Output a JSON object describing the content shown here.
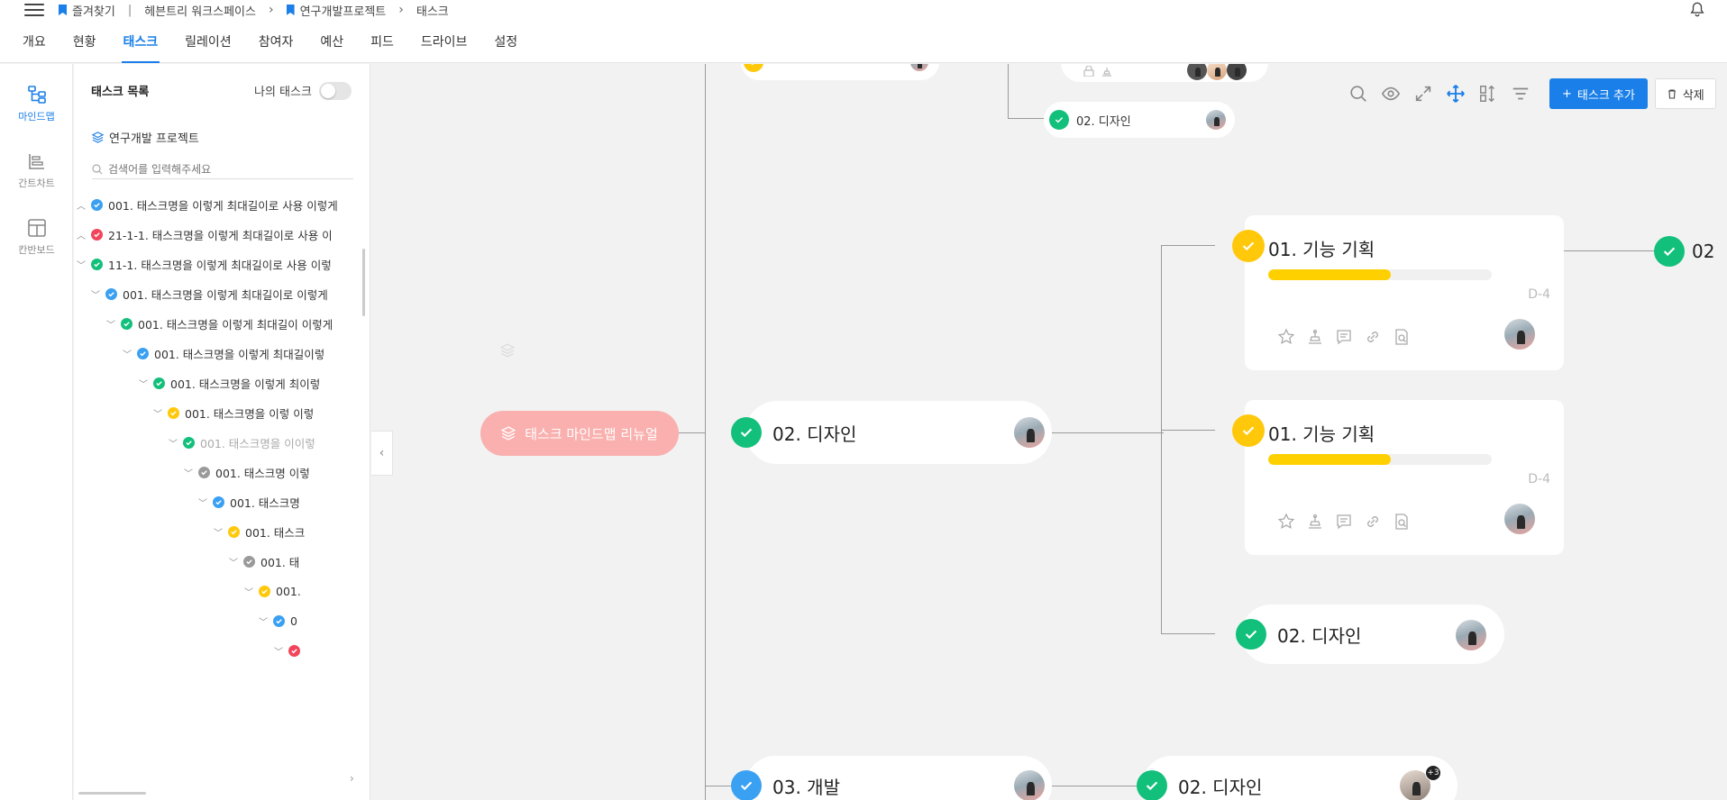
{
  "breadcrumb": {
    "favorites": "즐겨찾기",
    "workspace": "헤븐트리 워크스페이스",
    "project": "연구개발프로젝트",
    "current": "태스크"
  },
  "tabs": [
    "개요",
    "현황",
    "태스크",
    "릴레이션",
    "참여자",
    "예산",
    "피드",
    "드라이브",
    "설정"
  ],
  "active_tab": "태스크",
  "rail": {
    "mindmap": "마인드맵",
    "gantt": "간트차트",
    "kanban": "칸반보드"
  },
  "panel": {
    "title": "태스크 목록",
    "my_tasks": "나의 태스크",
    "my_tasks_on": false,
    "project": "연구개발 프로젝트",
    "search_placeholder": "검색어를 입력해주세요"
  },
  "tree": [
    {
      "label": "001.  태스크명을 이렇게 최대길이로 사용 이렇게",
      "status": "blue",
      "chevron": "up"
    },
    {
      "label": "21-1-1.  태스크명을 이렇게 최대길이로 사용 이",
      "status": "red",
      "chevron": "up"
    },
    {
      "label": "11-1.  태스크명을 이렇게 최대길이로 사용 이렇",
      "status": "green",
      "chevron": "down"
    },
    {
      "label": "001.  태스크명을 이렇게 최대길이로 이렇게",
      "status": "blue",
      "chevron": "down"
    },
    {
      "label": "001.  태스크명을 이렇게 최대길이 이렇게",
      "status": "green",
      "chevron": "down"
    },
    {
      "label": "001.  태스크명을 이렇게 최대길이렇",
      "status": "blue",
      "chevron": "down"
    },
    {
      "label": "001.  태스크명을 이렇게 최이렇",
      "status": "green",
      "chevron": "down"
    },
    {
      "label": "001.  태스크명을 이렇 이렇",
      "status": "yellow",
      "chevron": "down"
    },
    {
      "label": "001.  태스크명을 이이렇",
      "status": "green",
      "chevron": "down",
      "faded": true
    },
    {
      "label": "001.  태스크명 이렇",
      "status": "gray",
      "chevron": "down"
    },
    {
      "label": "001.  태스크명",
      "status": "blue",
      "chevron": "down"
    },
    {
      "label": "001.  태스크",
      "status": "yellow",
      "chevron": "down"
    },
    {
      "label": "001.  태",
      "status": "gray",
      "chevron": "down"
    },
    {
      "label": "001.",
      "status": "yellow",
      "chevron": "down"
    },
    {
      "label": "0",
      "status": "blue",
      "chevron": "down"
    },
    {
      "label": "",
      "status": "red",
      "chevron": "down"
    }
  ],
  "toolbar": {
    "add_task": "태스크 추가",
    "delete": "삭제"
  },
  "mindmap": {
    "root": "태스크 마인드맵 리뉴얼",
    "top_small_node": "02. 디자인",
    "design_node": "02. 디자인",
    "dev_node": "03. 개발",
    "dev_child": "02. 디자인",
    "dev_child_badge": "+3",
    "card1": {
      "title": "01. 기능 기획",
      "progress": 0.55,
      "dday": "D-4"
    },
    "card2": {
      "title": "01. 기능 기획",
      "progress": 0.55,
      "dday": "D-4"
    },
    "design_child3": "02. 디자인",
    "right_edge_node": "02"
  },
  "colors": {
    "blue": "#3aa0f2",
    "green": "#12c07b",
    "yellow": "#ffc80a",
    "red": "#f0455a",
    "gray": "#9a9a9a",
    "accent": "#1a7fe8"
  }
}
